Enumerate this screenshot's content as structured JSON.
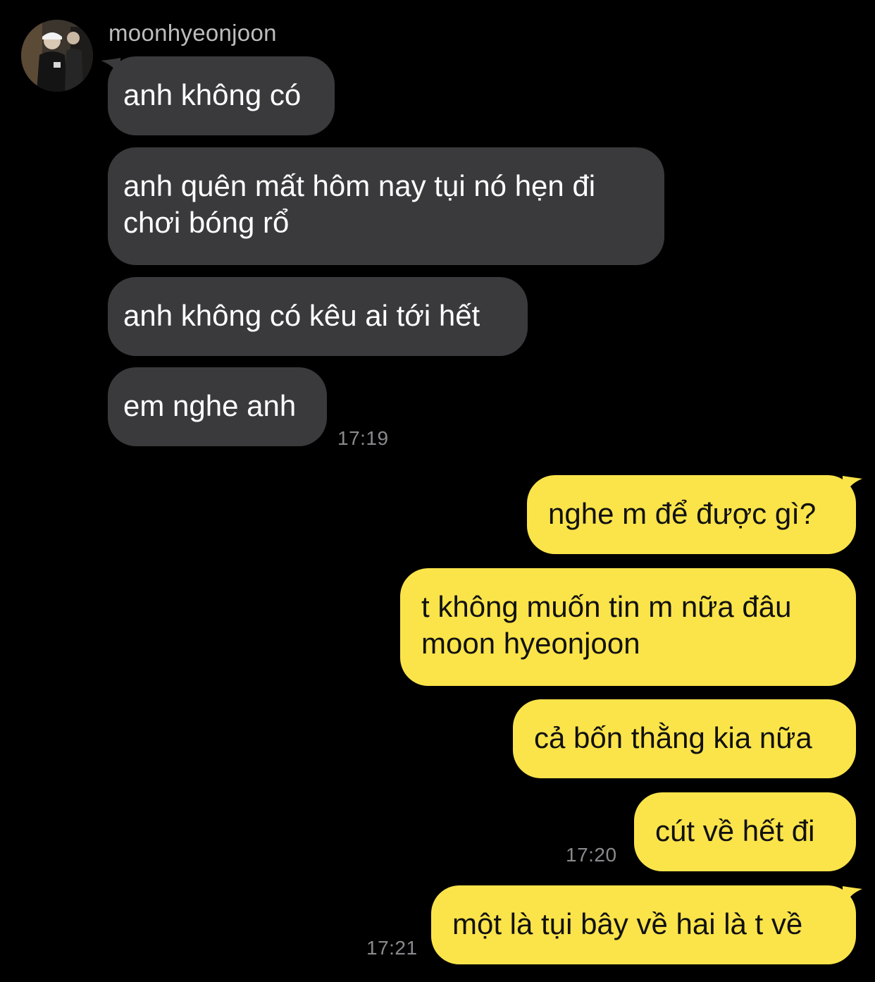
{
  "sender": {
    "name": "moonhyeonjoon"
  },
  "incoming": [
    {
      "text": "anh không có"
    },
    {
      "line1": "anh quên mất hôm nay tụi nó hẹn đi",
      "line2": "chơi bóng rổ"
    },
    {
      "text": "anh không có kêu ai tới hết"
    },
    {
      "text": "em nghe anh"
    }
  ],
  "incoming_time": "17:19",
  "outgoing": [
    {
      "text": "nghe m để được gì?"
    },
    {
      "line1": "t không muốn tin m nữa đâu",
      "line2": "moon hyeonjoon"
    },
    {
      "text": "cả bốn thằng kia nữa"
    },
    {
      "text": "cút về hết đi"
    },
    {
      "text": "một là tụi bây về hai là t về"
    }
  ],
  "outgoing_times": [
    "17:20",
    "17:21"
  ],
  "colors": {
    "background": "#000000",
    "incoming_bubble": "#3a3a3c",
    "outgoing_bubble": "#fbe44a",
    "timestamp": "#8a8a8e"
  }
}
